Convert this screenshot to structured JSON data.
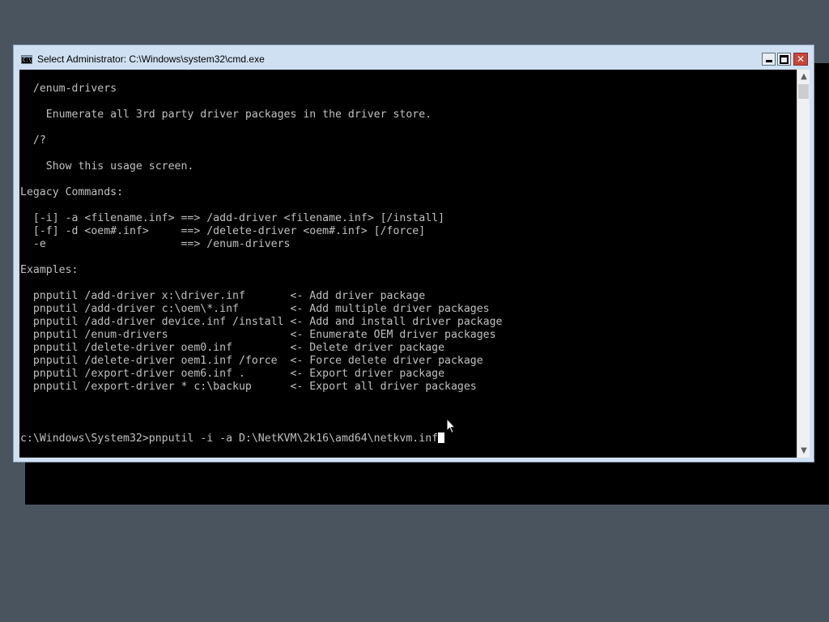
{
  "window": {
    "title": "Select Administrator: C:\\Windows\\system32\\cmd.exe",
    "icon": "cmd-icon",
    "icon_glyph": "C:\\",
    "minimize_icon": "minimize-icon",
    "maximize_icon": "maximize-icon",
    "close_icon": "close-icon",
    "close_glyph": "✕"
  },
  "console": {
    "lines": [
      "  /enum-drivers",
      "",
      "    Enumerate all 3rd party driver packages in the driver store.",
      "",
      "  /?",
      "",
      "    Show this usage screen.",
      "",
      "Legacy Commands:",
      "",
      "  [-i] -a <filename.inf> ==> /add-driver <filename.inf> [/install]",
      "  [-f] -d <oem#.inf>     ==> /delete-driver <oem#.inf> [/force]",
      "  -e                     ==> /enum-drivers",
      "",
      "Examples:",
      "",
      "  pnputil /add-driver x:\\driver.inf       <- Add driver package",
      "  pnputil /add-driver c:\\oem\\*.inf        <- Add multiple driver packages",
      "  pnputil /add-driver device.inf /install <- Add and install driver package",
      "  pnputil /enum-drivers                   <- Enumerate OEM driver packages",
      "  pnputil /delete-driver oem0.inf         <- Delete driver package",
      "  pnputil /delete-driver oem1.inf /force  <- Force delete driver package",
      "  pnputil /export-driver oem6.inf .       <- Export driver package",
      "  pnputil /export-driver * c:\\backup      <- Export all driver packages",
      "",
      "",
      ""
    ],
    "prompt_line": "c:\\Windows\\System32>pnputil -i -a D:\\NetKVM\\2k16\\amd64\\netkvm.inf"
  },
  "scrollbar": {
    "up_icon": "scroll-up-arrow-icon",
    "up_glyph": "▲",
    "down_icon": "scroll-down-arrow-icon",
    "down_glyph": "▼",
    "position_fraction": 0.0
  },
  "colors": {
    "console_bg": "#000000",
    "console_text": "#c0c0c0",
    "titlebar_bg": "#cfe0f2",
    "close_button": "#c7463a",
    "desktop": "#4a545f"
  }
}
